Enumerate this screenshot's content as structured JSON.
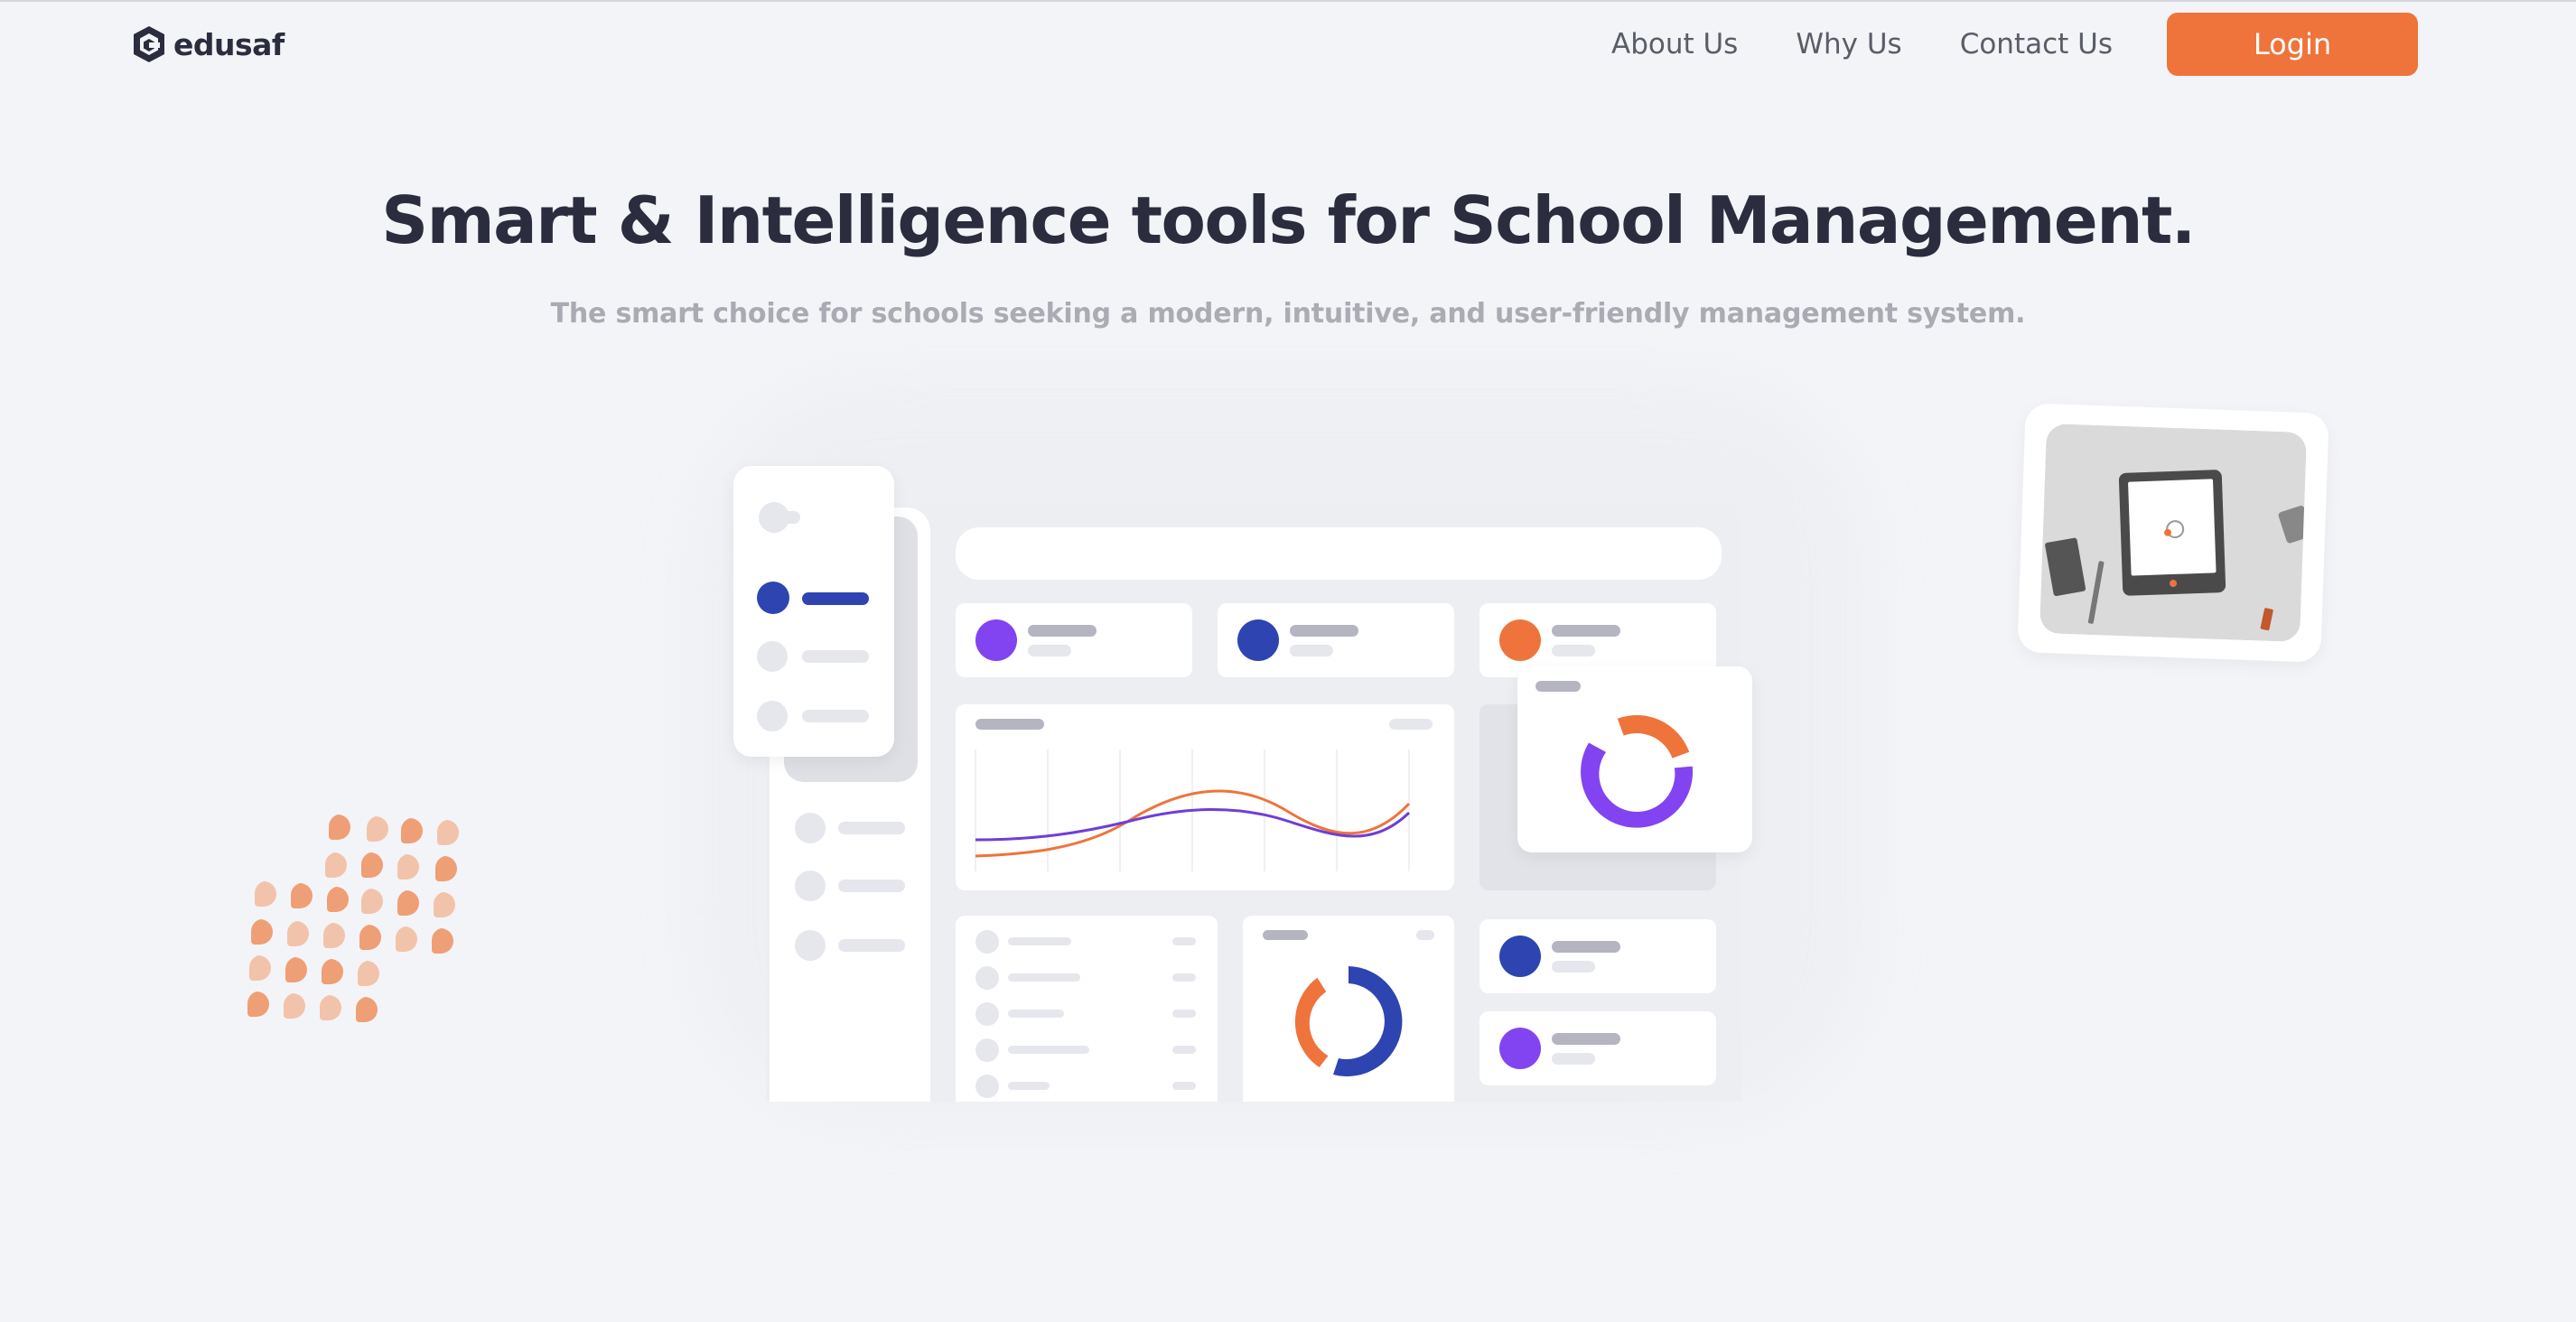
{
  "brand": {
    "name": "edusaf"
  },
  "nav": {
    "links": [
      {
        "label": "About Us"
      },
      {
        "label": "Why Us"
      },
      {
        "label": "Contact Us"
      }
    ],
    "login_label": "Login"
  },
  "hero": {
    "title": "Smart & Intelligence tools for School Management.",
    "subtitle": "The smart choice for schools seeking a modern, intuitive, and user-friendly management system."
  },
  "colors": {
    "accent": "#ee743b",
    "heading": "#2b2c3e",
    "navy": "#2e44b0",
    "purple": "#8244f0",
    "background": "#f3f4f7"
  },
  "icons": [
    "edusaf-logo-icon",
    "tablet-illustration",
    "petal-pattern"
  ]
}
